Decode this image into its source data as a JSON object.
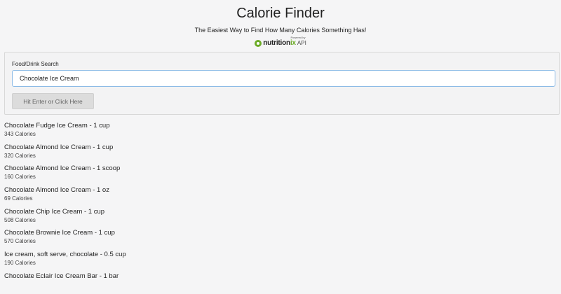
{
  "header": {
    "title": "Calorie Finder",
    "subtitle": "The Easiest Way to Find How Many Calories Something Has!",
    "powered_by": "Powered by",
    "logo_text_main": "nutrition",
    "logo_text_ix": "ix",
    "logo_api": "API",
    "accent_color": "#6cab27"
  },
  "search": {
    "label": "Food/Drink Search",
    "value": "Chocolate Ice Cream",
    "placeholder": "",
    "button_label": "Hit Enter or Click Here"
  },
  "results": [
    {
      "name": "Chocolate Fudge Ice Cream - 1 cup",
      "calories": "343 Calories"
    },
    {
      "name": "Chocolate Almond Ice Cream - 1 cup",
      "calories": "320 Calories"
    },
    {
      "name": "Chocolate Almond Ice Cream - 1 scoop",
      "calories": "160 Calories"
    },
    {
      "name": "Chocolate Almond Ice Cream - 1 oz",
      "calories": "69 Calories"
    },
    {
      "name": "Chocolate Chip Ice Cream - 1 cup",
      "calories": "508 Calories"
    },
    {
      "name": "Chocolate Brownie Ice Cream - 1 cup",
      "calories": "570 Calories"
    },
    {
      "name": "Ice cream, soft serve, chocolate - 0.5 cup",
      "calories": "190 Calories"
    },
    {
      "name": "Chocolate Eclair Ice Cream Bar - 1 bar",
      "calories": ""
    }
  ]
}
